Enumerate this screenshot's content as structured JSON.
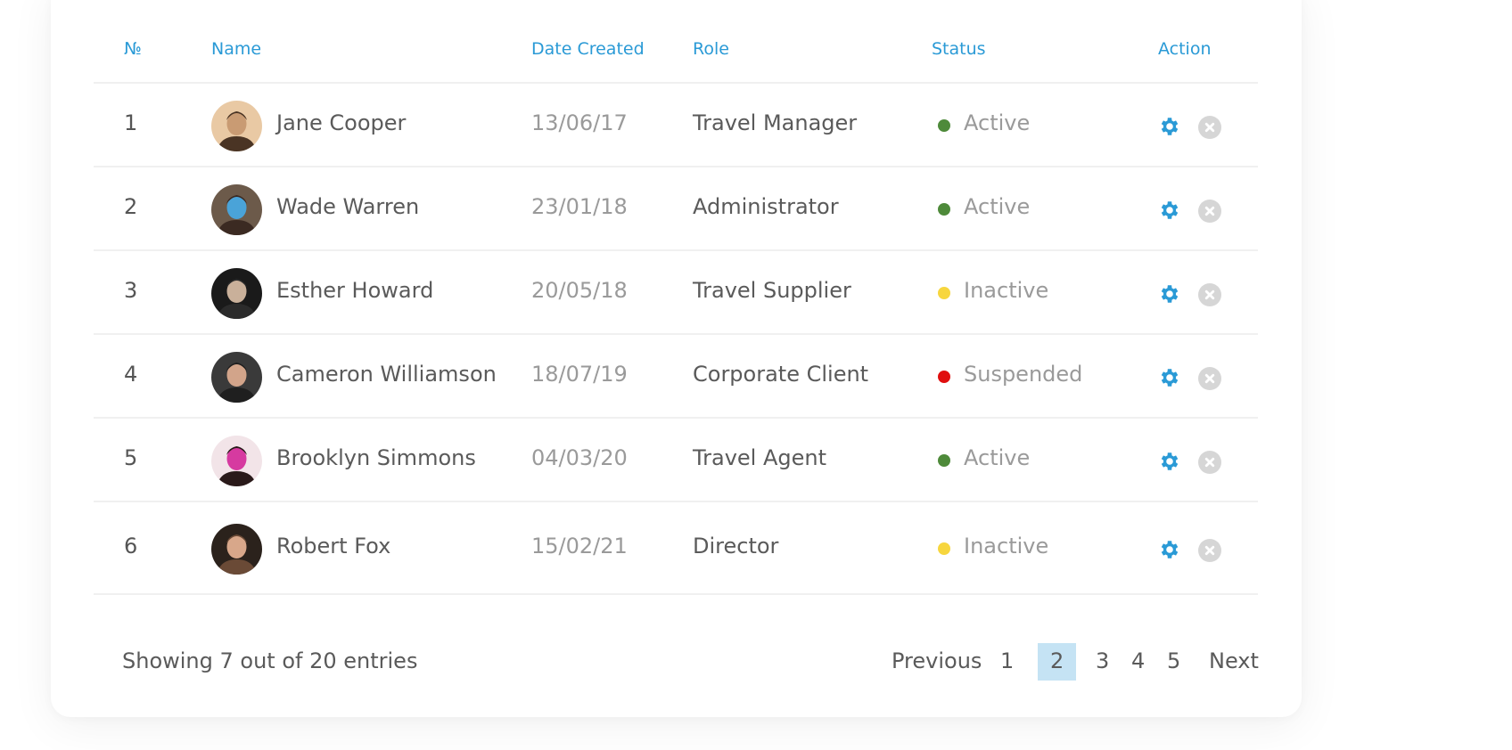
{
  "table": {
    "headers": {
      "number": "№",
      "name": "Name",
      "date_created": "Date Created",
      "role": "Role",
      "status": "Status",
      "action": "Action"
    },
    "rows": [
      {
        "number": "1",
        "name": "Jane Cooper",
        "date_created": "13/06/17",
        "role": "Travel Manager",
        "status": "Active",
        "status_color": "#4e8a3a",
        "avatar": "avatar-photo-man-glasses"
      },
      {
        "number": "2",
        "name": "Wade Warren",
        "date_created": "23/01/18",
        "role": "Administrator",
        "status": "Active",
        "status_color": "#4e8a3a",
        "avatar": "avatar-photo-man-smiling"
      },
      {
        "number": "3",
        "name": "Esther Howard",
        "date_created": "20/05/18",
        "role": "Travel Supplier",
        "status": "Inactive",
        "status_color": "#f7d63e",
        "avatar": "avatar-photo-man-dark"
      },
      {
        "number": "4",
        "name": "Cameron Williamson",
        "date_created": "18/07/19",
        "role": "Corporate Client",
        "status": "Suspended",
        "status_color": "#e00f0f",
        "avatar": "avatar-photo-man-beard"
      },
      {
        "number": "5",
        "name": "Brooklyn Simmons",
        "date_created": "04/03/20",
        "role": "Travel Agent",
        "status": "Active",
        "status_color": "#4e8a3a",
        "avatar": "avatar-photo-woman-dark-hair"
      },
      {
        "number": "6",
        "name": "Robert Fox",
        "date_created": "15/02/21",
        "role": "Director",
        "status": "Inactive",
        "status_color": "#f7d63e",
        "avatar": "avatar-photo-woman-freckles"
      }
    ],
    "action_icons": [
      "gear-icon",
      "close-circle-icon"
    ]
  },
  "footer": {
    "entries_text": "Showing 7 out of 20 entries"
  },
  "pagination": {
    "previous": "Previous",
    "pages": [
      "1",
      "2",
      "3",
      "4",
      "5"
    ],
    "current": "2",
    "next": "Next"
  },
  "colors": {
    "accent": "#2a9ad6",
    "active_page_bg": "#c5e3f4",
    "close_icon": "#d6d6d6"
  }
}
